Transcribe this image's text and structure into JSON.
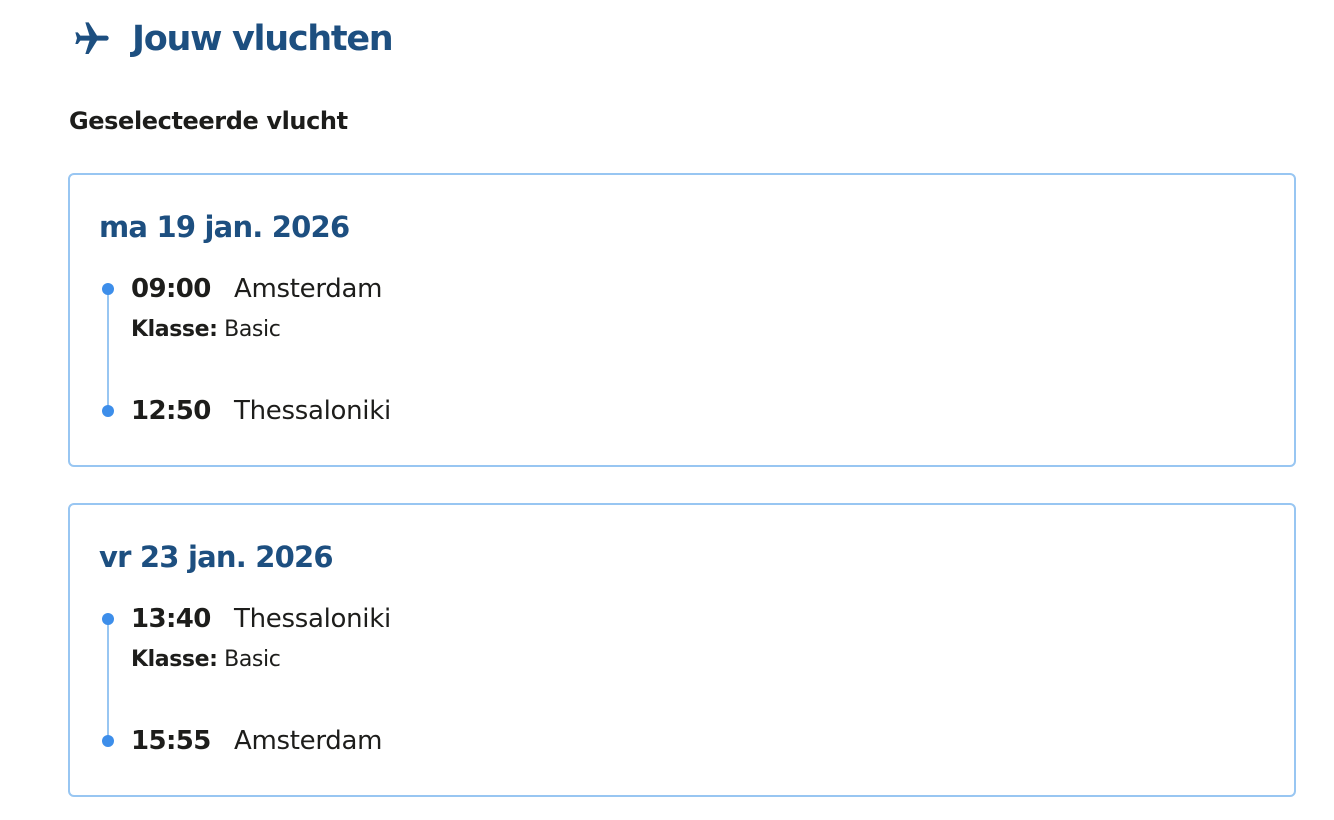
{
  "header": {
    "title": "Jouw vluchten",
    "icon": "airplane-icon",
    "color": "#1d4f80"
  },
  "section_title": "Geselecteerde vlucht",
  "colors": {
    "accent": "#1d4f80",
    "card_border": "#98c6f2",
    "timeline_dot": "#3d8eea",
    "text": "#1d1d1b"
  },
  "flights": [
    {
      "date": "ma 19 jan. 2026",
      "departure": {
        "time": "09:00",
        "city": "Amsterdam"
      },
      "class_label": "Klasse:",
      "class_value": "Basic",
      "arrival": {
        "time": "12:50",
        "city": "Thessaloniki"
      }
    },
    {
      "date": "vr 23 jan. 2026",
      "departure": {
        "time": "13:40",
        "city": "Thessaloniki"
      },
      "class_label": "Klasse:",
      "class_value": "Basic",
      "arrival": {
        "time": "15:55",
        "city": "Amsterdam"
      }
    }
  ]
}
